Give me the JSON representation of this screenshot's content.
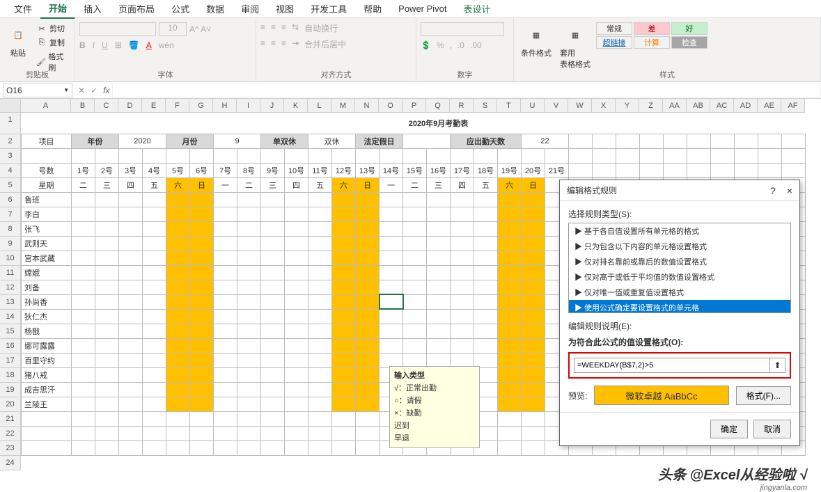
{
  "ribbon": {
    "tabs": [
      "文件",
      "开始",
      "插入",
      "页面布局",
      "公式",
      "数据",
      "审阅",
      "视图",
      "开发工具",
      "帮助",
      "Power Pivot",
      "表设计"
    ],
    "active_tab": "开始",
    "clipboard": {
      "label": "剪贴板",
      "paste": "粘贴",
      "cut": "剪切",
      "copy": "复制",
      "painter": "格式刷"
    },
    "font": {
      "label": "字体",
      "size": "10"
    },
    "align": {
      "label": "对齐方式",
      "wrap": "自动换行",
      "merge": "合并后居中"
    },
    "number": {
      "label": "数字"
    },
    "styles": {
      "label": "样式",
      "cond": "条件格式",
      "table": "套用\n表格格式",
      "normal": "常规",
      "bad": "差",
      "good": "好",
      "link": "超链接",
      "calc": "计算",
      "check": "检查"
    }
  },
  "namebox": "O16",
  "columns": [
    "A",
    "B",
    "C",
    "D",
    "E",
    "F",
    "G",
    "H",
    "I",
    "J",
    "K",
    "L",
    "M",
    "N",
    "O",
    "P",
    "Q",
    "R",
    "S",
    "T",
    "U",
    "V",
    "W",
    "X",
    "Y",
    "Z",
    "AA",
    "AB",
    "AC",
    "AD",
    "AE",
    "AF"
  ],
  "rows_count": 24,
  "title": "2020年9月考勤表",
  "header_row": {
    "proj": "项目",
    "year_l": "年份",
    "year_v": "2020",
    "month_l": "月份",
    "month_v": "9",
    "rest_l": "单双休",
    "rest_v": "双休",
    "holiday_l": "法定假日",
    "holiday_v": "",
    "days_l": "应出勤天数",
    "days_v": "22"
  },
  "day_header": "号数",
  "days": [
    "1号",
    "2号",
    "3号",
    "4号",
    "5号",
    "6号",
    "7号",
    "8号",
    "9号",
    "10号",
    "11号",
    "12号",
    "13号",
    "14号",
    "15号",
    "16号",
    "17号",
    "18号",
    "19号",
    "20号",
    "21号"
  ],
  "week_header": "星期",
  "weekdays": [
    "二",
    "三",
    "四",
    "五",
    "六",
    "日",
    "一",
    "二",
    "三",
    "四",
    "五",
    "六",
    "日",
    "一",
    "二",
    "三",
    "四",
    "五",
    "六",
    "日"
  ],
  "names": [
    "鲁班",
    "李白",
    "张飞",
    "武则天",
    "宫本武藏",
    "嫦娥",
    "刘备",
    "孙尚香",
    "狄仁杰",
    "杨戬",
    "娜可露露",
    "百里守约",
    "猪八戒",
    "成吉思汗",
    "兰陵王"
  ],
  "tooltip": {
    "title": "输入类型",
    "l1": "√：正常出勤",
    "l2": "○：请假",
    "l3": "×：缺勤",
    "l4": "迟到",
    "l5": "早退"
  },
  "dialog": {
    "title": "编辑格式规则",
    "help": "?",
    "close": "×",
    "select_label": "选择规则类型(S):",
    "rules": [
      "▶ 基于各自值设置所有单元格的格式",
      "▶ 只为包含以下内容的单元格设置格式",
      "▶ 仅对排名靠前或靠后的数值设置格式",
      "▶ 仅对高于或低于平均值的数值设置格式",
      "▶ 仅对唯一值或重复值设置格式",
      "▶ 使用公式确定要设置格式的单元格"
    ],
    "desc_label": "编辑规则说明(E):",
    "formula_label": "为符合此公式的值设置格式(O):",
    "formula": "=WEEKDAY(B$7,2)>5",
    "preview_label": "预览:",
    "preview_text": "微软卓越 AaBbCc",
    "format_btn": "格式(F)...",
    "ok": "确定",
    "cancel": "取消"
  },
  "watermark": "头条 @Excel从经验啦 √",
  "watermark2": "jingyanla.com"
}
